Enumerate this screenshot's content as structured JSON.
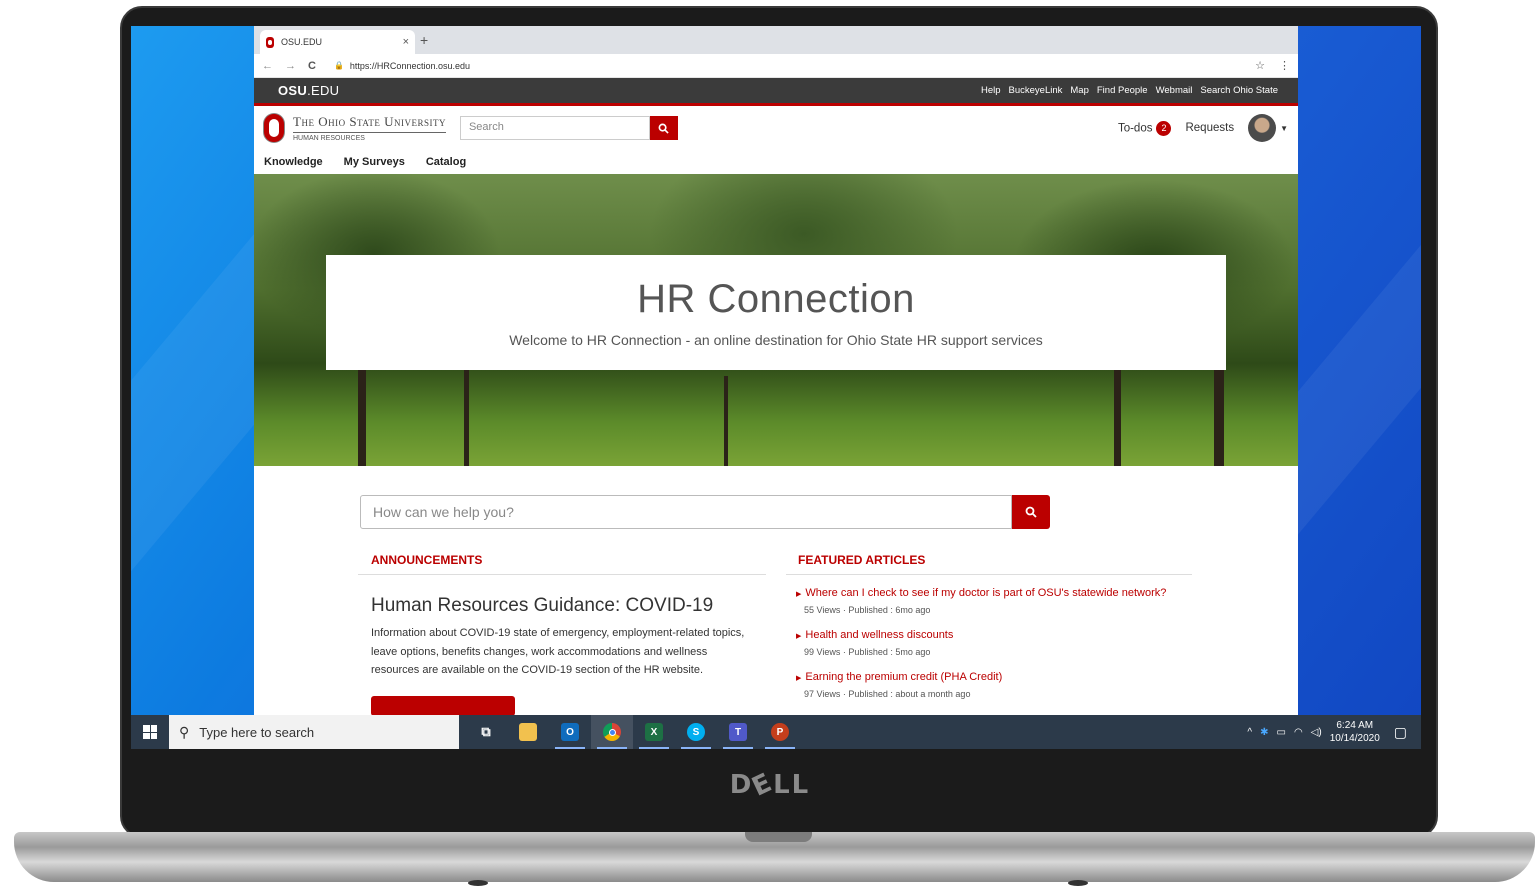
{
  "browser": {
    "tab_title": "OSU.EDU",
    "tab_close": "×",
    "new_tab": "+",
    "url": "https://HRConnection.osu.edu"
  },
  "osu_bar": {
    "brand_bold": "OSU",
    "brand_light": ".EDU",
    "links": [
      "Help",
      "BuckeyeLink",
      "Map",
      "Find People",
      "Webmail",
      "Search Ohio State"
    ]
  },
  "header": {
    "university": "The Ohio State University",
    "department": "HUMAN RESOURCES",
    "search_placeholder": "Search",
    "todos_label": "To-dos",
    "todos_count": "2",
    "requests_label": "Requests"
  },
  "subnav": [
    "Knowledge",
    "My Surveys",
    "Catalog"
  ],
  "hero": {
    "title": "HR Connection",
    "subtitle": "Welcome to HR Connection - an online destination for Ohio State HR support services"
  },
  "main_search": {
    "placeholder": "How can we help you?"
  },
  "announcements": {
    "heading": "ANNOUNCEMENTS",
    "title": "Human Resources Guidance: COVID-19",
    "body": "Information about COVID-19 state of emergency, employment-related topics, leave options, benefits changes, work accommodations and wellness resources are available on the COVID-19 section of the HR website."
  },
  "featured": {
    "heading": "FEATURED ARTICLES",
    "articles": [
      {
        "title": "Where can I check to see if my doctor is part of OSU's statewide network?",
        "meta": "55 Views  ·  Published : 6mo ago"
      },
      {
        "title": "Health and wellness discounts",
        "meta": "99 Views  ·  Published : 5mo ago"
      },
      {
        "title": "Earning the premium credit (PHA Credit)",
        "meta": "97 Views  ·  Published : about a month ago"
      }
    ]
  },
  "taskbar": {
    "search_placeholder": "Type here to search",
    "time": "6:24 AM",
    "date": "10/14/2020"
  },
  "laptop": {
    "brand": "DØLL"
  },
  "colors": {
    "osu_scarlet": "#bb0000",
    "osu_gray": "#3b3b3b",
    "taskbar": "#2c3a4a"
  }
}
